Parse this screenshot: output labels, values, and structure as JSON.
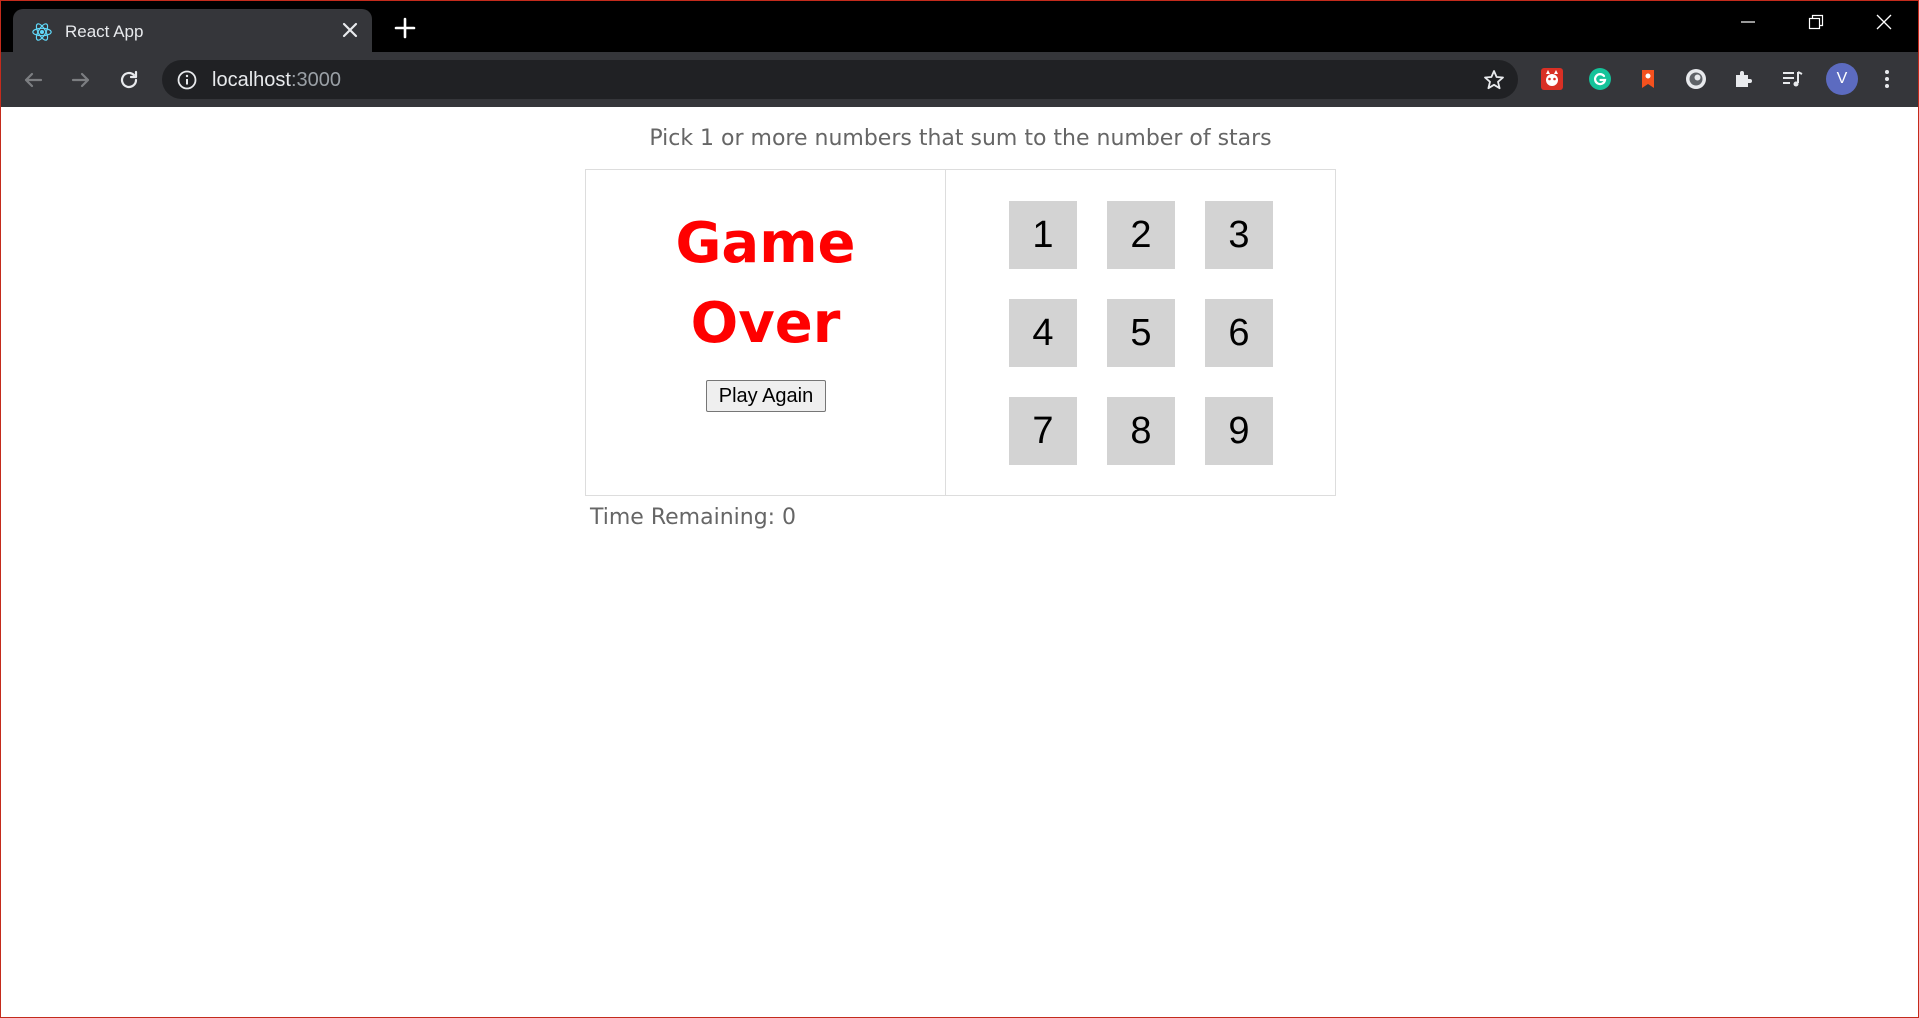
{
  "browser": {
    "tab_title": "React App",
    "url_host": "localhost",
    "url_port": ":3000",
    "profile_initial": "V",
    "extensions": [
      "ninja-cat-icon",
      "grammarly-icon",
      "bookmark-extension-icon",
      "circle-extension-icon",
      "puzzle-icon",
      "media-queue-icon"
    ]
  },
  "game": {
    "help_text": "Pick 1 or more numbers that sum to the number of stars",
    "status_line1": "Game",
    "status_line2": "Over",
    "status_color": "#ff0000",
    "play_again_label": "Play Again",
    "numbers": [
      "1",
      "2",
      "3",
      "4",
      "5",
      "6",
      "7",
      "8",
      "9"
    ],
    "timer_text": "Time Remaining: 0"
  }
}
